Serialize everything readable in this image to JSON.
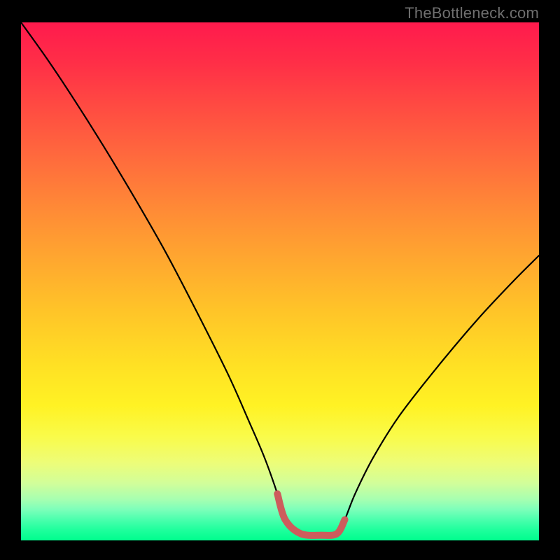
{
  "watermark": "TheBottleneck.com",
  "chart_data": {
    "type": "line",
    "title": "",
    "xlabel": "",
    "ylabel": "",
    "xlim": [
      0,
      100
    ],
    "ylim": [
      0,
      100
    ],
    "grid": false,
    "legend": false,
    "series": [
      {
        "name": "curve",
        "color": "#000000",
        "x": [
          0,
          5,
          10,
          16,
          22,
          28,
          34,
          40,
          44,
          47,
          49.5,
          51,
          54,
          58,
          61,
          62.5,
          64.5,
          68,
          73,
          80,
          88,
          95,
          100
        ],
        "y": [
          100,
          93,
          85.5,
          76,
          66,
          55.5,
          44,
          32,
          23,
          16,
          9,
          4,
          1.3,
          1.0,
          1.3,
          4,
          9,
          16,
          24,
          33,
          42.5,
          50,
          55
        ]
      },
      {
        "name": "bottom-segment",
        "color": "#cd5c5c",
        "x": [
          49.5,
          51,
          54,
          58,
          61,
          62.5
        ],
        "y": [
          9,
          4,
          1.3,
          1.0,
          1.3,
          4
        ]
      }
    ]
  }
}
